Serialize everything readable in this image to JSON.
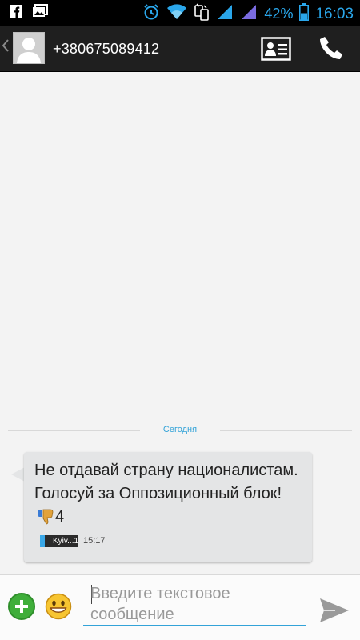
{
  "status_bar": {
    "battery_percent": "42%",
    "time": "16:03"
  },
  "header": {
    "contact": "+380675089412"
  },
  "conversation": {
    "date_separator": "Сегодня",
    "messages": [
      {
        "text": "Не отдавай страну националистам. Голосуй за Оппозиционный блок!",
        "count": "4",
        "sim": "Kyiv...1",
        "time": "15:17"
      }
    ]
  },
  "composer": {
    "placeholder": "Введите текстовое сообщение"
  },
  "colors": {
    "accent": "#33a3d8",
    "status_icons": "#2aa6ea",
    "add_button": "#3fae3a"
  }
}
